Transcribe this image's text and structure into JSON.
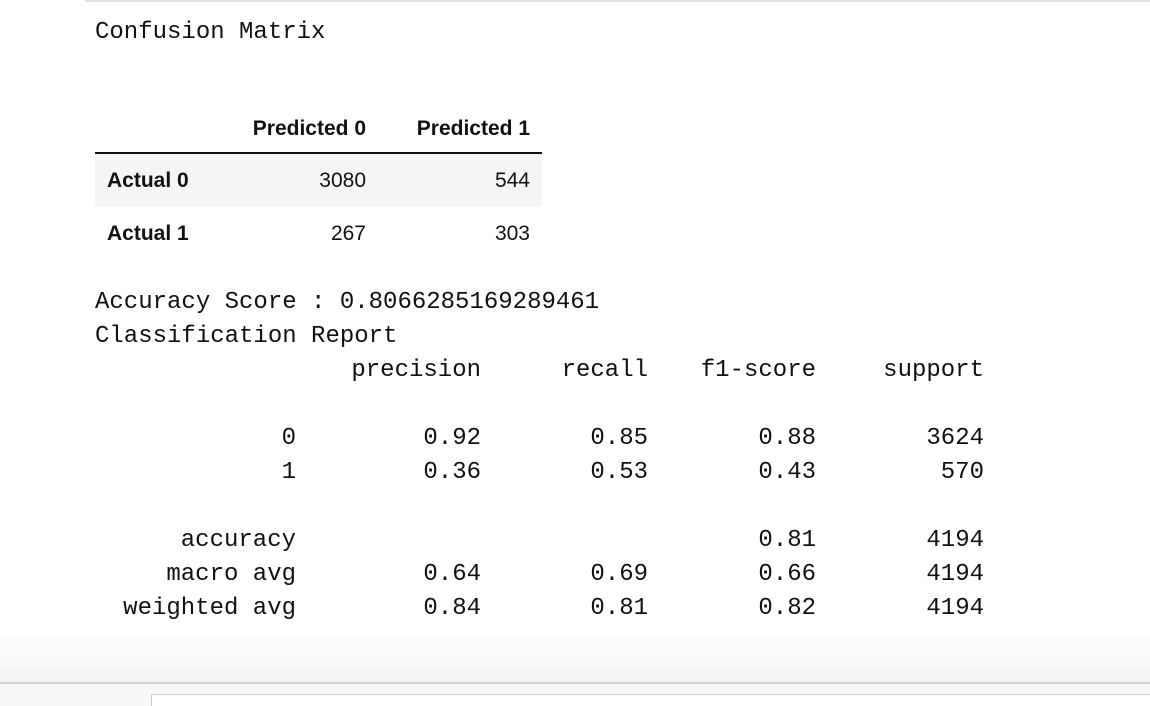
{
  "confusion_matrix": {
    "title": "Confusion Matrix",
    "columns": [
      "Predicted 0",
      "Predicted 1"
    ],
    "rows": [
      {
        "label": "Actual 0",
        "values": [
          "3080",
          "544"
        ]
      },
      {
        "label": "Actual 1",
        "values": [
          "267",
          "303"
        ]
      }
    ]
  },
  "accuracy": {
    "text": "Accuracy Score : 0.8066285169289461"
  },
  "report": {
    "title": "Classification Report",
    "headers": [
      "precision",
      "recall",
      "f1-score",
      "support"
    ],
    "rows": [
      {
        "label": "0",
        "precision": "0.92",
        "recall": "0.85",
        "f1": "0.88",
        "support": "3624"
      },
      {
        "label": "1",
        "precision": "0.36",
        "recall": "0.53",
        "f1": "0.43",
        "support": "570"
      }
    ],
    "summary": [
      {
        "label": "accuracy",
        "precision": "",
        "recall": "",
        "f1": "0.81",
        "support": "4194"
      },
      {
        "label": "macro avg",
        "precision": "0.64",
        "recall": "0.69",
        "f1": "0.66",
        "support": "4194"
      },
      {
        "label": "weighted avg",
        "precision": "0.84",
        "recall": "0.81",
        "f1": "0.82",
        "support": "4194"
      }
    ]
  }
}
